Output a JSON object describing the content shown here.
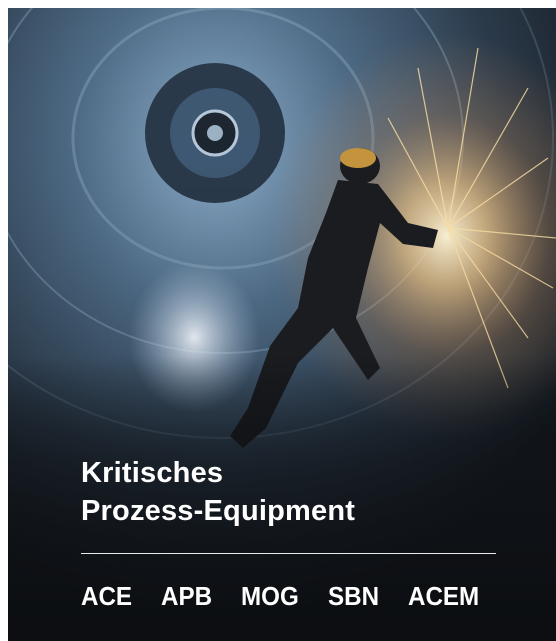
{
  "hero": {
    "title_line1": "Kritisches",
    "title_line2": "Prozess-Equipment"
  },
  "brands": [
    "ACE",
    "APB",
    "MOG",
    "SBN",
    "ACEM"
  ],
  "colors": {
    "text": "#ffffff",
    "divider": "#e9e9e9",
    "spark": "#ffe9b0",
    "steel": "#6f8ca8"
  }
}
